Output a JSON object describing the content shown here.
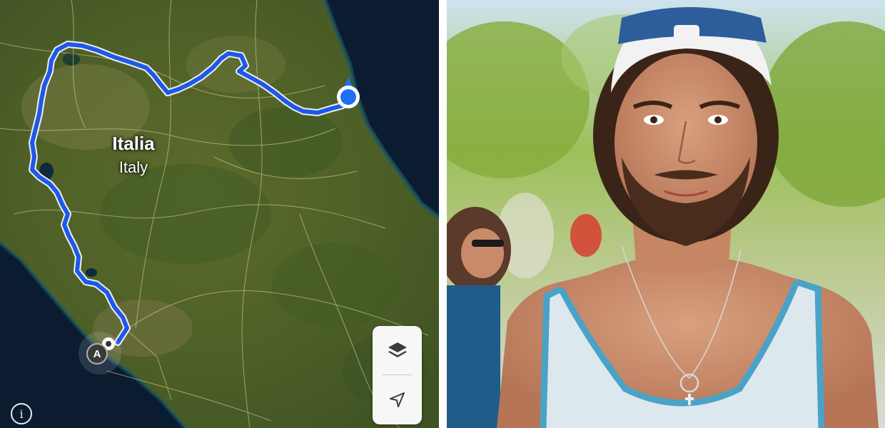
{
  "map": {
    "country_label_native": "Italia",
    "country_label_english": "Italy",
    "start_marker_label": "A",
    "info_symbol": "i",
    "icons": {
      "layers": "layers-icon",
      "locate": "location-arrow-icon",
      "info": "info-icon",
      "current_location": "current-location-icon",
      "start": "start-pin-icon"
    },
    "colors": {
      "route": "#1f58e8",
      "location_dot": "#1e6ff5",
      "sea": "#0a1a2f",
      "land": "#5b6a2e"
    }
  }
}
